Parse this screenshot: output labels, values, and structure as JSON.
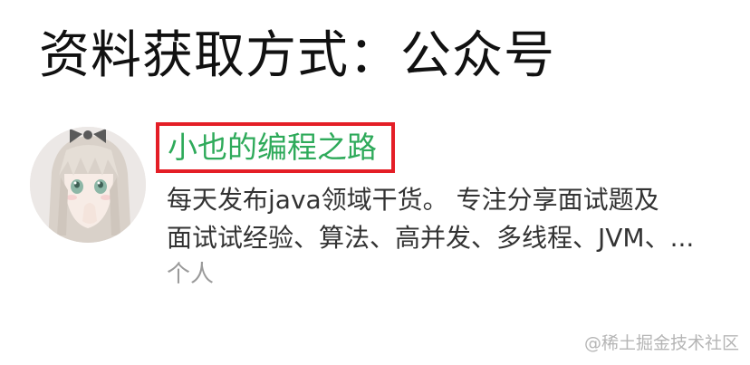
{
  "heading": "资料获取方式：公众号",
  "account": {
    "name": "小也的编程之路",
    "description_line1": "每天发布java领域干货。 专注分享面试题及",
    "description_line2": "面试试经验、算法、高并发、多线程、JVM、...",
    "type": "个人"
  },
  "watermark": "@稀土掘金技术社区",
  "colors": {
    "name_green": "#2eaa5a",
    "highlight_red": "#e41e26"
  }
}
